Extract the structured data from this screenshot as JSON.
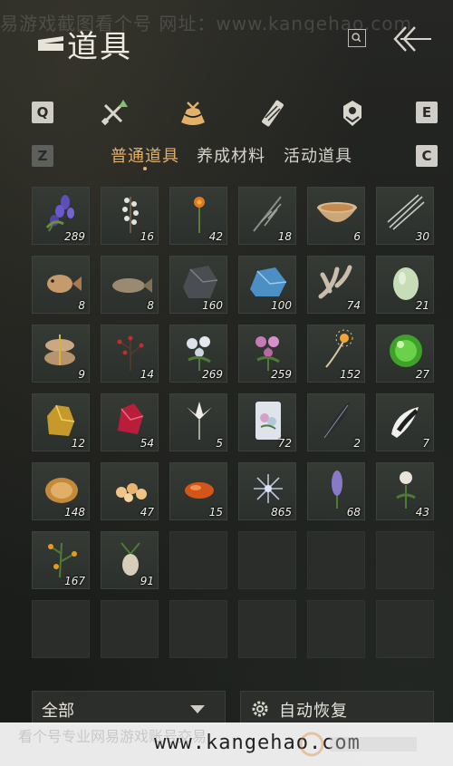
{
  "watermark": {
    "top_text": "易游戏截图看个号  网址：www.kangehao.com"
  },
  "header": {
    "title": "道具"
  },
  "keys": {
    "prev_category": "Q",
    "next_category": "E",
    "prev_subtab": "Z",
    "next_subtab": "C"
  },
  "categories": [
    {
      "icon": "weapons-icon"
    },
    {
      "icon": "item-bag-icon",
      "active": true
    },
    {
      "icon": "scroll-icon"
    },
    {
      "icon": "badge-icon"
    }
  ],
  "subtabs": [
    {
      "label": "普通道具",
      "active": true
    },
    {
      "label": "养成材料"
    },
    {
      "label": "活动道具"
    }
  ],
  "items": [
    {
      "icon": "purple-flower-icon",
      "count": "289"
    },
    {
      "icon": "white-blossom-icon",
      "count": "16"
    },
    {
      "icon": "orange-flower-icon",
      "count": "42"
    },
    {
      "icon": "grass-sprig-icon",
      "count": "18"
    },
    {
      "icon": "bowl-icon",
      "count": "6"
    },
    {
      "icon": "needles-icon",
      "count": "30"
    },
    {
      "icon": "pufferfish-icon",
      "count": "8"
    },
    {
      "icon": "fish-icon",
      "count": "8"
    },
    {
      "icon": "dark-ore-icon",
      "count": "160"
    },
    {
      "icon": "blue-crystal-icon",
      "count": "100"
    },
    {
      "icon": "coral-icon",
      "count": "74"
    },
    {
      "icon": "melon-icon",
      "count": "21"
    },
    {
      "icon": "rice-sacks-icon",
      "count": "9"
    },
    {
      "icon": "red-berries-icon",
      "count": "14"
    },
    {
      "icon": "white-flowers-icon",
      "count": "269"
    },
    {
      "icon": "pink-flowers-icon",
      "count": "259"
    },
    {
      "icon": "firework-icon",
      "count": "152"
    },
    {
      "icon": "green-orb-icon",
      "count": "27"
    },
    {
      "icon": "gold-ore-icon",
      "count": "12"
    },
    {
      "icon": "red-gem-icon",
      "count": "54"
    },
    {
      "icon": "white-lily-icon",
      "count": "5"
    },
    {
      "icon": "flower-box-icon",
      "count": "72"
    },
    {
      "icon": "black-feather-icon",
      "count": "2"
    },
    {
      "icon": "white-fur-icon",
      "count": "7"
    },
    {
      "icon": "shell-icon",
      "count": "148"
    },
    {
      "icon": "dumplings-icon",
      "count": "47"
    },
    {
      "icon": "orange-pill-icon",
      "count": "15"
    },
    {
      "icon": "frost-flower-icon",
      "count": "865"
    },
    {
      "icon": "lavender-icon",
      "count": "68"
    },
    {
      "icon": "white-rose-icon",
      "count": "43"
    },
    {
      "icon": "kumquat-branch-icon",
      "count": "167"
    },
    {
      "icon": "root-herb-icon",
      "count": "91"
    }
  ],
  "filter": {
    "label": "全部"
  },
  "auto_restore": {
    "label": "自动恢复"
  },
  "footer": {
    "slogan": "看个号专业网易游戏账号交易",
    "url": "www.kangehao.com"
  },
  "colors": {
    "accent": "#e2b06a",
    "slot_bg": "#353a35",
    "page_bg": "#1c1e1c"
  }
}
